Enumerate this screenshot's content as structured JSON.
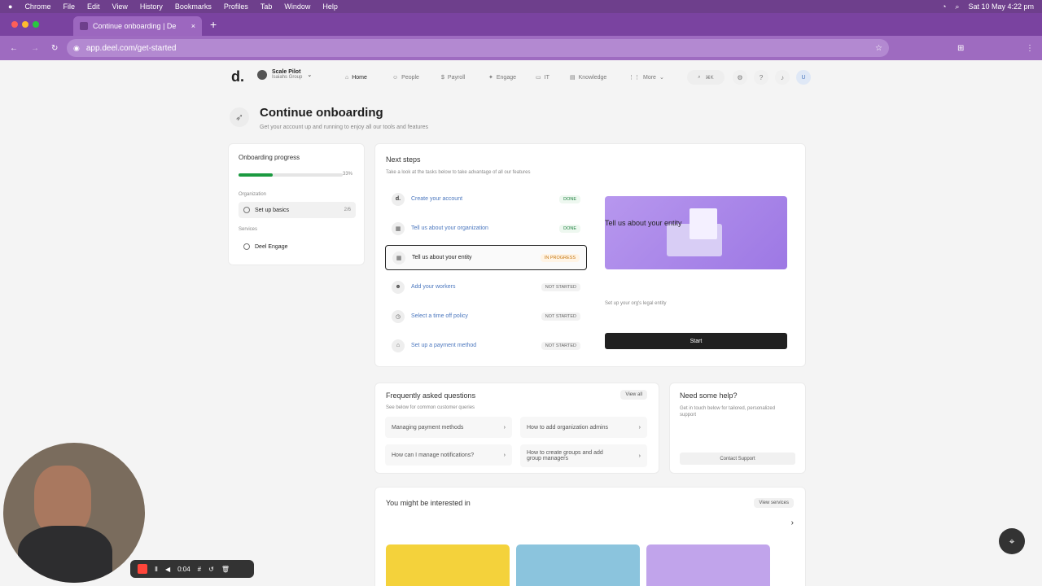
{
  "mac_menu": [
    "Chrome",
    "File",
    "Edit",
    "View",
    "History",
    "Bookmarks",
    "Profiles",
    "Tab",
    "Window",
    "Help"
  ],
  "mac_time": "Sat 10 May  4:22 pm",
  "tab_title": "Continue onboarding | De",
  "url": "app.deel.com/get-started",
  "workspace": {
    "name": "Scale Pilot",
    "group": "Isaiahs Group"
  },
  "nav": [
    "Home",
    "People",
    "Payroll",
    "Engage",
    "IT",
    "Knowledge",
    "More"
  ],
  "search_shortcut": "⌘K",
  "avatar_initial": "U",
  "header": {
    "title": "Continue onboarding",
    "subtitle": "Get your account up and running to enjoy all our tools and features"
  },
  "progress": {
    "title": "Onboarding progress",
    "percent_label": "33%",
    "value": 0.33,
    "org_label": "Organization",
    "basics_label": "Set up basics",
    "basics_count": "2/6",
    "services_label": "Services",
    "engage_label": "Deel Engage"
  },
  "next_steps": {
    "title": "Next steps",
    "subtitle": "Take a look at the tasks below to take advantage of all our features",
    "steps": [
      {
        "label": "Create your account",
        "status": "DONE"
      },
      {
        "label": "Tell us about your organization",
        "status": "DONE"
      },
      {
        "label": "Tell us about your entity",
        "status": "IN PROGRESS"
      },
      {
        "label": "Add your workers",
        "status": "NOT STARTED"
      },
      {
        "label": "Select a time off policy",
        "status": "NOT STARTED"
      },
      {
        "label": "Set up a payment method",
        "status": "NOT STARTED"
      }
    ]
  },
  "entity_card": {
    "title": "Tell us about your entity",
    "desc": "Set up your org's legal entity",
    "button": "Start"
  },
  "faq": {
    "title": "Frequently asked questions",
    "subtitle": "See below for common customer queries",
    "view_all": "View all",
    "items": [
      "Managing payment methods",
      "How to add organization admins",
      "How can I manage notifications?",
      "How to create groups and add group managers"
    ]
  },
  "help": {
    "title": "Need some help?",
    "desc": "Get in touch below for tailored, personalized support",
    "button": "Contact Support"
  },
  "interest": {
    "title": "You might be interested in",
    "button": "View services"
  },
  "recorder": {
    "time": "0:04"
  }
}
